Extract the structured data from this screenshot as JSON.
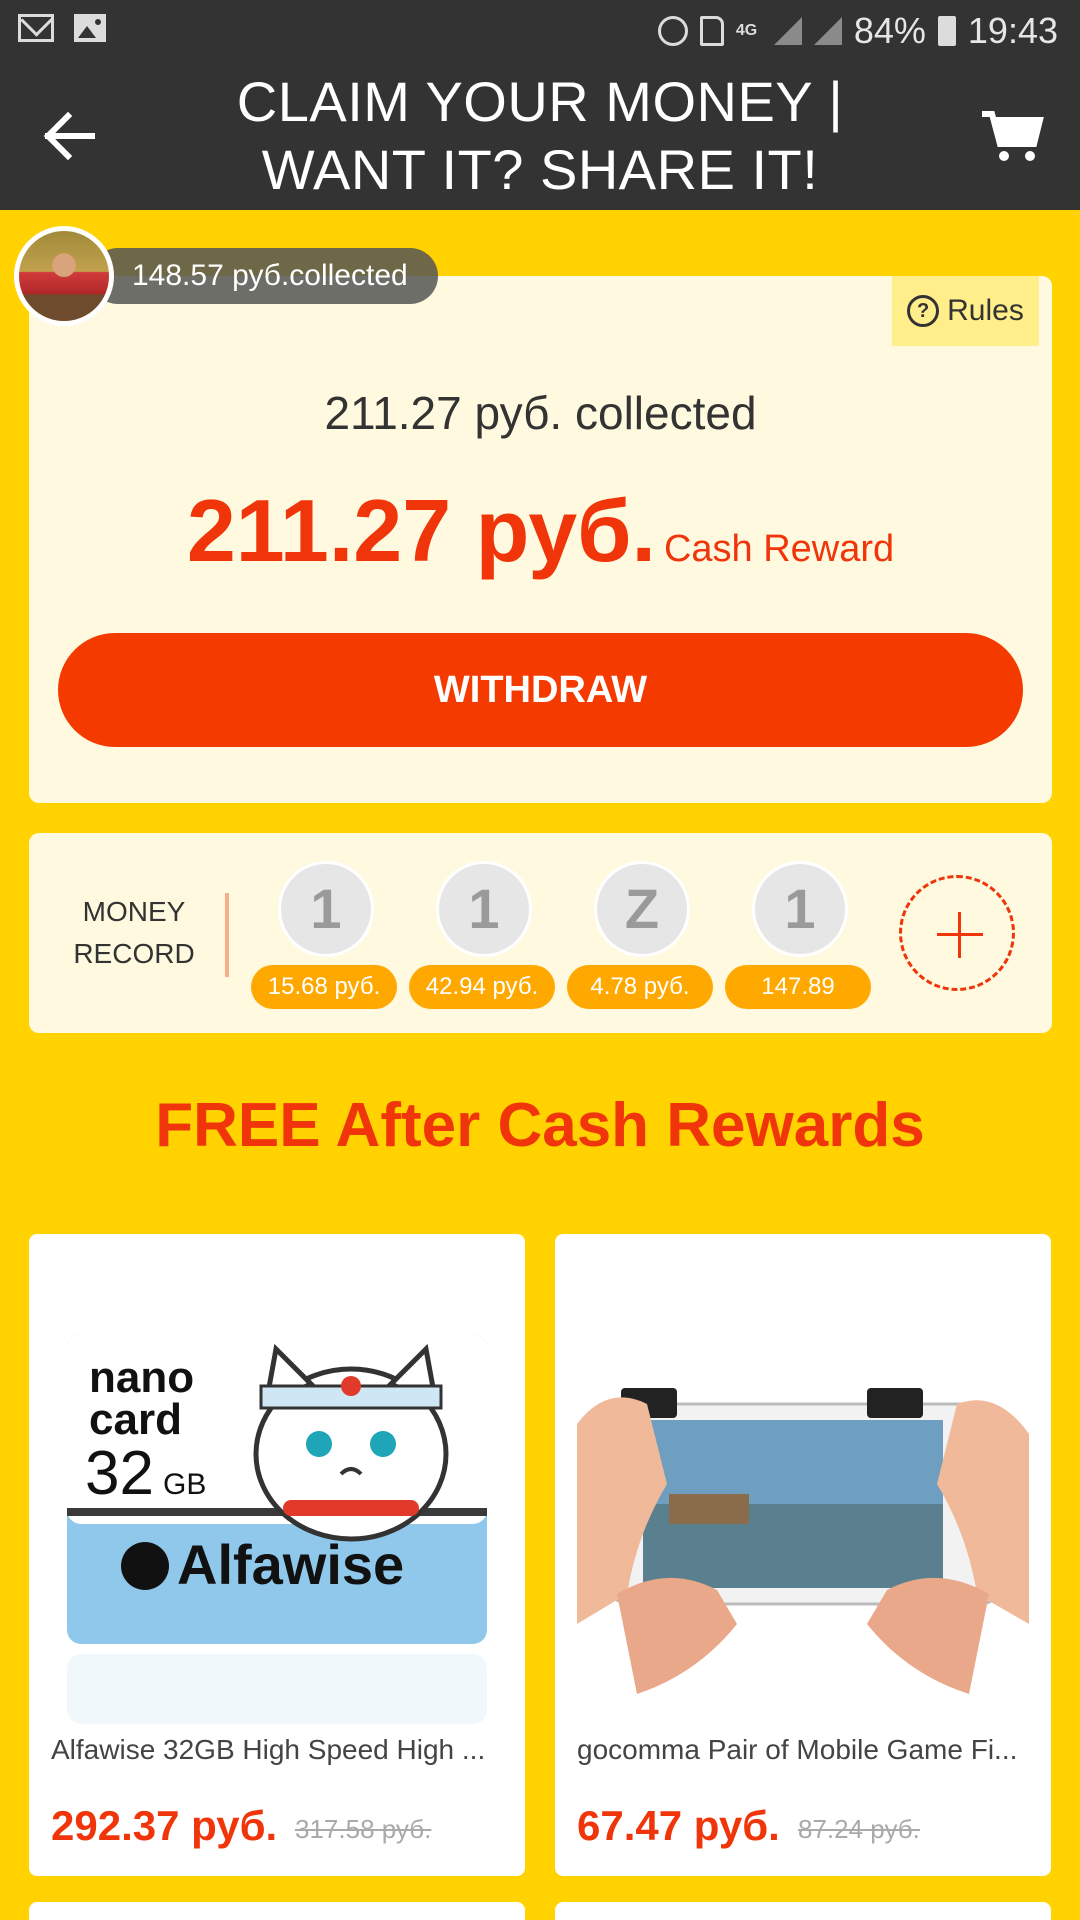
{
  "status_bar": {
    "battery": "84%",
    "time": "19:43",
    "network": "4G",
    "icons": [
      "mail-icon",
      "image-icon",
      "alarm-icon",
      "sim-icon",
      "4g-icon",
      "signal-icon",
      "battery-icon"
    ]
  },
  "header": {
    "title": "CLAIM YOUR MONEY | WANT IT? SHARE IT!",
    "back_icon": "arrow-left-icon",
    "cart_icon": "cart-icon"
  },
  "reward_card": {
    "friend_collected": "148.57 руб.collected",
    "rules_label": "Rules",
    "collected_text": "211.27 руб. collected",
    "amount": "211.27 руб.",
    "amount_suffix": "Cash Reward",
    "withdraw_label": "WITHDRAW"
  },
  "money_record": {
    "label": "MONEY RECORD",
    "items": [
      {
        "initial": "1",
        "amount": "15.68 руб."
      },
      {
        "initial": "1",
        "amount": "42.94 руб."
      },
      {
        "initial": "Z",
        "amount": "4.78 руб."
      },
      {
        "initial": "1",
        "amount": "147.89"
      }
    ],
    "add_icon": "plus-icon"
  },
  "section_title": "FREE After Cash Rewards",
  "products": [
    {
      "name": "Alfawise 32GB High Speed High ...",
      "price": "292.37 руб.",
      "old_price": "317.58 руб.",
      "image_text": {
        "line1": "nano",
        "line2": "card",
        "capacity": "32",
        "unit": "GB",
        "brand": "Alfawise"
      }
    },
    {
      "name": "gocomma Pair of Mobile Game Fi...",
      "price": "67.47 руб.",
      "old_price": "87.24 руб."
    }
  ],
  "colors": {
    "background": "#FFD200",
    "accent": "#F0350A",
    "card": "#FFFADF",
    "bar": "#333333",
    "badge": "#FFA800"
  }
}
